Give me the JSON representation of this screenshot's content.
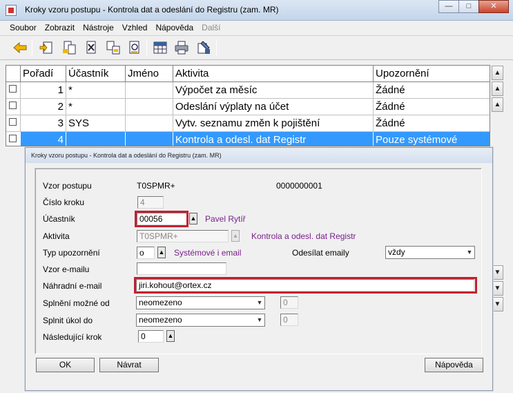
{
  "window": {
    "title": "Kroky vzoru postupu - Kontrola dat a odeslání do Registru (zam. MR)"
  },
  "menu": [
    "Soubor",
    "Zobrazit",
    "Nástroje",
    "Vzhled",
    "Nápověda",
    "Další"
  ],
  "grid": {
    "headers": [
      "Pořadí",
      "Účastník",
      "Jméno",
      "Aktivita",
      "Upozornění"
    ],
    "rows": [
      {
        "poradi": "1",
        "ucastnik": "*",
        "jmeno": "",
        "aktivita": "Výpočet za měsíc",
        "upozorneni": "Žádné"
      },
      {
        "poradi": "2",
        "ucastnik": "*",
        "jmeno": "",
        "aktivita": "Odeslání výplaty na účet",
        "upozorneni": "Žádné"
      },
      {
        "poradi": "3",
        "ucastnik": "SYS",
        "jmeno": "",
        "aktivita": "Vytv. seznamu změn k pojištění",
        "upozorneni": "Žádné"
      },
      {
        "poradi": "4",
        "ucastnik": "",
        "jmeno": "",
        "aktivita": "Kontrola a odesl. dat Registr",
        "upozorneni": "Pouze systémové"
      }
    ]
  },
  "dialog": {
    "title": "Kroky vzoru postupu - Kontrola dat a odeslání do Registru (zam. MR)",
    "vzor_postupu_label": "Vzor postupu",
    "vzor_postupu_code": "T0SPMR+",
    "vzor_postupu_id": "0000000001",
    "cislo_kroku_label": "Číslo kroku",
    "cislo_kroku_value": "4",
    "ucastnik_label": "Účastník",
    "ucastnik_value": "00056",
    "ucastnik_name": "Pavel Rytíř",
    "aktivita_label": "Aktivita",
    "aktivita_value": "T0SPMR+",
    "aktivita_name": "Kontrola a odesl. dat Registr",
    "typ_upozorneni_label": "Typ upozornění",
    "typ_upozorneni_value": "o",
    "typ_upozorneni_name": "Systémové i email",
    "odesilat_emaily_label": "Odesílat emaily",
    "odesilat_emaily_value": "vždy",
    "vzor_emailu_label": "Vzor e-mailu",
    "vzor_emailu_value": "",
    "nahradni_email_label": "Náhradní e-mail",
    "nahradni_email_value": "jiri.kohout@ortex.cz",
    "splneni_mozne_od_label": "Splnění možné od",
    "splneni_mozne_od_value": "neomezeno",
    "splneni_mozne_od_num": "0",
    "splnit_ukol_do_label": "Splnit úkol do",
    "splnit_ukol_do_value": "neomezeno",
    "splnit_ukol_do_num": "0",
    "nasledujici_krok_label": "Následující krok",
    "nasledujici_krok_value": "0",
    "ok_label": "OK",
    "navrat_label": "Návrat",
    "napoveda_label": "Nápověda"
  },
  "colors": {
    "selection": "#3399ff",
    "highlight_red": "#c3212f",
    "purple_text": "#7a1f8a"
  }
}
